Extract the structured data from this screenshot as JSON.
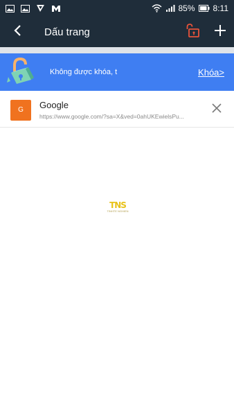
{
  "status_bar": {
    "battery": "85%",
    "time": "8:11",
    "icons_left": [
      "image-icon",
      "image-icon",
      "navigation-app-icon",
      "messenger-app-icon"
    ],
    "icons_right": [
      "wifi-icon",
      "signal-icon",
      "battery-icon"
    ]
  },
  "app_bar": {
    "title": "Dấu trang",
    "colors": {
      "background": "#1f2d3a",
      "lock_accent": "#e8533a"
    }
  },
  "banner": {
    "text": "Không được khóa, t",
    "link": "Khóa>",
    "background": "#3f7ef2"
  },
  "bookmarks": [
    {
      "favicon_letter": "G",
      "title": "Google",
      "url": "https://www.google.com/?sa=X&ved=0ahUKEwielsPu..."
    }
  ],
  "watermark": {
    "logo": "TNS",
    "sub": "TINHTE NGHIEN"
  }
}
